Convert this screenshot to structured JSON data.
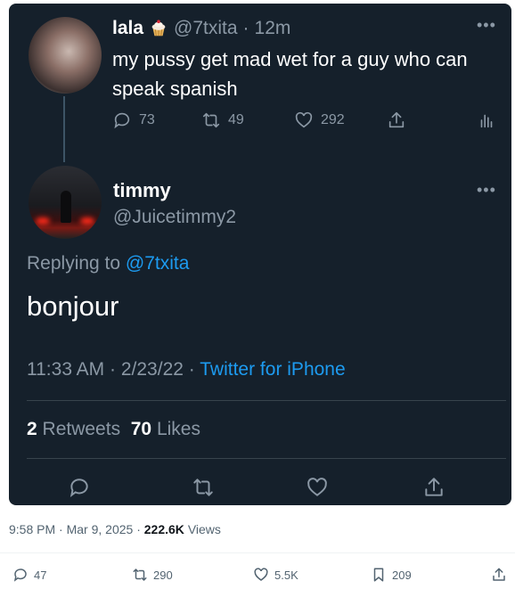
{
  "quoted_tweet": {
    "author_name": "lala",
    "author_handle": "@7txita",
    "time_ago": "12m",
    "emoji_icon": "cupcake-icon",
    "text": "my pussy get mad wet for a guy who can speak spanish",
    "replies": "73",
    "retweets": "49",
    "likes": "292"
  },
  "main_tweet": {
    "author_name": "timmy",
    "author_handle": "@Juicetimmy2",
    "replying_prefix": "Replying to",
    "replying_to": "@7txita",
    "text": "bonjour",
    "time": "11:33 AM",
    "date": "2/23/22",
    "source": "Twitter for iPhone",
    "retweets_count": "2",
    "retweets_label": "Retweets",
    "likes_count": "70",
    "likes_label": "Likes"
  },
  "outer_tweet": {
    "time": "9:58 PM",
    "date": "Mar 9, 2025",
    "views_count": "222.6K",
    "views_label": "Views",
    "replies": "47",
    "reposts": "290",
    "likes": "5.5K",
    "bookmarks": "209"
  },
  "separator": "·",
  "colors": {
    "card_bg": "#15202b",
    "muted": "#8b98a5",
    "accent": "#1d9bf0",
    "light_muted": "#536471"
  }
}
